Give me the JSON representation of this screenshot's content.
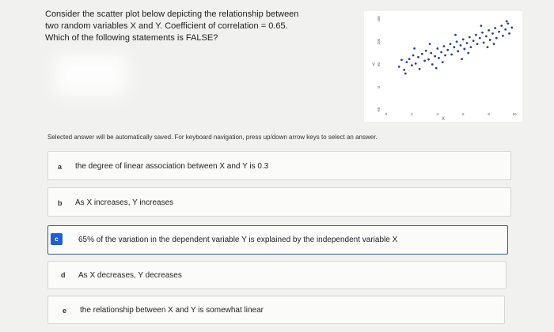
{
  "question": {
    "text": "Consider the scatter plot below depicting the relationship between two random variables X and Y. Coefficient of correlation = 0.65. Which of the following statements is FALSE?"
  },
  "instructions": "Selected answer will be automatically saved. For keyboard navigation, press up/down arrow keys to select an answer.",
  "options": [
    {
      "letter": "a",
      "text": "the degree of linear association between X and Y is 0.3"
    },
    {
      "letter": "b",
      "text": "As X increases, Y increases"
    },
    {
      "letter": "c",
      "text": "65% of the variation in the dependent variable Y is explained by the independent variable X"
    },
    {
      "letter": "d",
      "text": "As X decreases, Y decreases"
    },
    {
      "letter": "e",
      "text": "the relationship between X and Y is somewhat linear"
    }
  ],
  "selected_option": "c",
  "colors": {
    "accent": "#1f5fd1",
    "points": "#2c3f8f"
  },
  "chart_data": {
    "type": "scatter",
    "xlabel": "X",
    "ylabel": "Y",
    "xlim": [
      0,
      10
    ],
    "ylim": [
      -50,
      150
    ],
    "xticks": [
      "0",
      "2",
      "4",
      "6",
      "8",
      "10"
    ],
    "yticks": [
      "-50",
      "0",
      "50",
      "100",
      "150"
    ],
    "series": [
      {
        "values": [
          [
            1.0,
            45
          ],
          [
            1.2,
            60
          ],
          [
            1.4,
            38
          ],
          [
            1.6,
            55
          ],
          [
            1.8,
            62
          ],
          [
            2.0,
            48
          ],
          [
            2.1,
            70
          ],
          [
            2.3,
            52
          ],
          [
            2.5,
            66
          ],
          [
            2.6,
            40
          ],
          [
            2.8,
            73
          ],
          [
            3.0,
            58
          ],
          [
            3.1,
            80
          ],
          [
            3.3,
            61
          ],
          [
            3.5,
            75
          ],
          [
            3.6,
            50
          ],
          [
            3.8,
            68
          ],
          [
            4.0,
            85
          ],
          [
            4.1,
            64
          ],
          [
            4.3,
            77
          ],
          [
            4.5,
            90
          ],
          [
            4.6,
            70
          ],
          [
            4.8,
            82
          ],
          [
            5.0,
            95
          ],
          [
            5.1,
            72
          ],
          [
            5.3,
            88
          ],
          [
            5.5,
            100
          ],
          [
            5.6,
            79
          ],
          [
            5.8,
            92
          ],
          [
            6.0,
            105
          ],
          [
            6.1,
            84
          ],
          [
            6.3,
            97
          ],
          [
            6.5,
            110
          ],
          [
            6.6,
            88
          ],
          [
            6.8,
            102
          ],
          [
            7.0,
            115
          ],
          [
            7.1,
            95
          ],
          [
            7.3,
            108
          ],
          [
            7.5,
            120
          ],
          [
            7.6,
            98
          ],
          [
            7.8,
            112
          ],
          [
            8.0,
            125
          ],
          [
            8.1,
            104
          ],
          [
            8.3,
            118
          ],
          [
            8.5,
            130
          ],
          [
            8.6,
            108
          ],
          [
            8.8,
            122
          ],
          [
            9.0,
            135
          ],
          [
            9.1,
            113
          ],
          [
            9.3,
            127
          ],
          [
            9.5,
            140
          ],
          [
            9.6,
            118
          ],
          [
            9.8,
            131
          ],
          [
            1.5,
            30
          ],
          [
            2.2,
            85
          ],
          [
            3.4,
            95
          ],
          [
            4.4,
            55
          ],
          [
            5.4,
            115
          ],
          [
            6.4,
            75
          ],
          [
            7.4,
            135
          ],
          [
            8.4,
            95
          ],
          [
            9.4,
            145
          ],
          [
            3.9,
            42
          ],
          [
            5.9,
            62
          ],
          [
            7.9,
            88
          ]
        ]
      }
    ]
  }
}
